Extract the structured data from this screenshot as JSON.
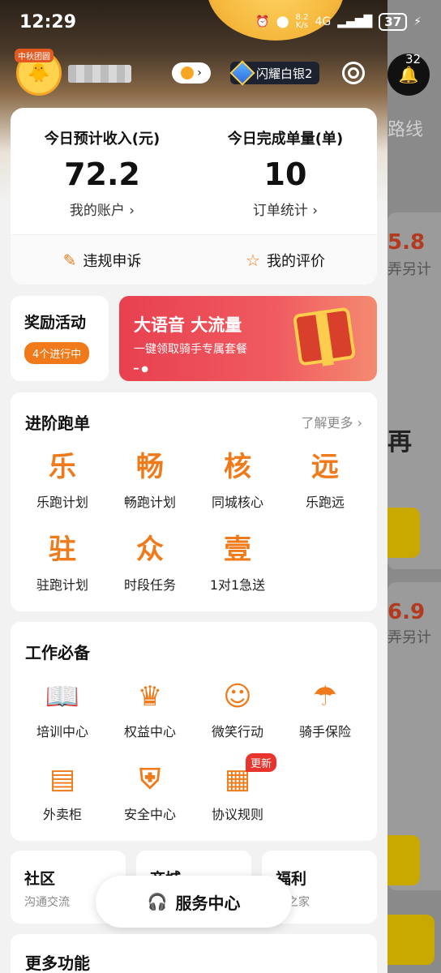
{
  "status_bar": {
    "time": "12:29",
    "net_speed_value": "8.2",
    "net_speed_unit": "K/s",
    "network": "4G",
    "battery": "37"
  },
  "header": {
    "avatar_tag": "中秋团圆",
    "rank_label": "闪耀白银2",
    "notification_count": "32"
  },
  "income_card": {
    "income_label": "今日预计收入(元)",
    "income_value": "72.2",
    "account_link": "我的账户 ›",
    "orders_label": "今日完成单量(单)",
    "orders_value": "10",
    "orders_link": "订单统计 ›",
    "complaint_label": "违规申诉",
    "rating_label": "我的评价"
  },
  "reward": {
    "title": "奖励活动",
    "tag": "4个进行中"
  },
  "banner": {
    "headline": "大语音 大流量",
    "subline": "一键领取骑手专属套餐"
  },
  "advance": {
    "title": "进阶跑单",
    "more": "了解更多 ›",
    "items": [
      {
        "glyph": "乐",
        "label": "乐跑计划"
      },
      {
        "glyph": "畅",
        "label": "畅跑计划"
      },
      {
        "glyph": "核",
        "label": "同城核心"
      },
      {
        "glyph": "远",
        "label": "乐跑远"
      },
      {
        "glyph": "驻",
        "label": "驻跑计划"
      },
      {
        "glyph": "众",
        "label": "时段任务"
      },
      {
        "glyph": "壹",
        "label": "1对1急送"
      }
    ]
  },
  "work": {
    "title": "工作必备",
    "new_badge": "更新",
    "items": [
      {
        "glyph": "📖",
        "label": "培训中心"
      },
      {
        "glyph": "♛",
        "label": "权益中心"
      },
      {
        "glyph": "☺",
        "label": "微笑行动"
      },
      {
        "glyph": "☂",
        "label": "骑手保险"
      },
      {
        "glyph": "▤",
        "label": "外卖柜"
      },
      {
        "glyph": "⛨",
        "label": "安全中心"
      },
      {
        "glyph": "▦",
        "label": "协议规则"
      }
    ]
  },
  "community": {
    "title": "社区",
    "sub": "沟通交流"
  },
  "mall": {
    "title": "商城"
  },
  "welfare": {
    "title": "福利",
    "sub": "手之家"
  },
  "service_center": "服务中心",
  "more_functions": "更多功能",
  "background_app": {
    "route": "路线",
    "num1": "5.8",
    "small1": "弄另计",
    "big1": "再",
    "num2": "6.9",
    "small2": "弄另计"
  }
}
